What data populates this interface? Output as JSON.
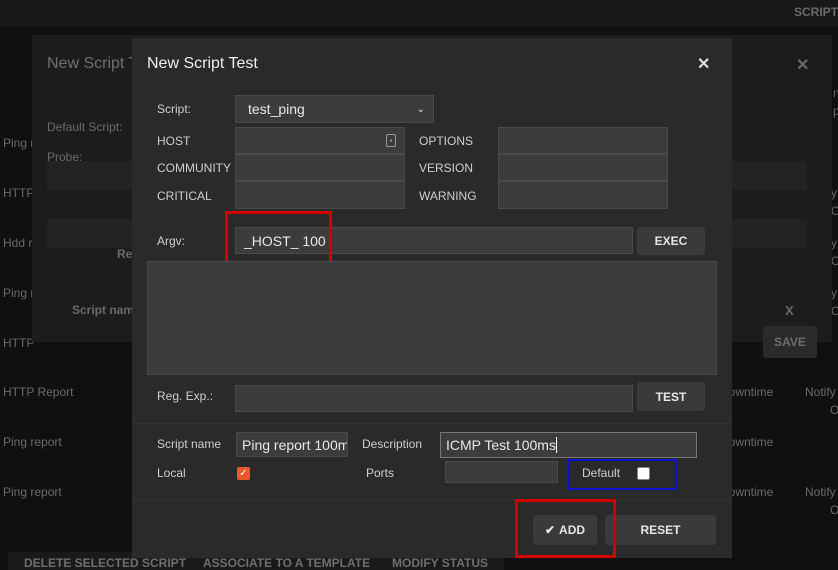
{
  "topbar": {
    "right_label": "SCRIPT"
  },
  "background_list": {
    "left_items": [
      "Ping r",
      "HTTP",
      "Hdd r",
      "Ping r",
      "HTTP",
      "HTTP Report",
      "Ping report",
      "Ping report"
    ],
    "right_downtime": "Downtime",
    "right_notify": "Notify",
    "right_o": "O",
    "right_partial": [
      "nt",
      "pe",
      "y",
      "O"
    ],
    "bottom_buttons": [
      "DELETE SELECTED SCRIPT",
      "ASSOCIATE TO A TEMPLATE",
      "MODIFY STATUS"
    ]
  },
  "back_modal": {
    "title": "New Script T",
    "default_script": "Default Script:",
    "probe": "Probe:",
    "re": "Re",
    "script_name": "Script name",
    "x": "X",
    "save": "SAVE"
  },
  "modal": {
    "title": "New Script Test",
    "script_label": "Script:",
    "script_value": "test_ping",
    "host": "HOST",
    "community": "COMMUNITY",
    "critical": "CRITICAL",
    "options": "OPTIONS",
    "version": "VERSION",
    "warning": "WARNING",
    "argv_label": "Argv:",
    "argv_value": "_HOST_ 100",
    "exec": "EXEC",
    "output": "",
    "regexp_label": "Reg. Exp.:",
    "regexp_value": "",
    "test": "TEST",
    "script_name_label": "Script name",
    "script_name_value": "Ping report 100ms",
    "description_label": "Description",
    "description_value": "ICMP Test 100ms",
    "local_label": "Local",
    "local_checked": true,
    "ports_label": "Ports",
    "ports_value": "",
    "default_label": "Default",
    "default_checked": false,
    "add": "ADD",
    "reset": "RESET"
  },
  "colors": {
    "accent": "#e9572b",
    "highlight_red": "#d00000",
    "highlight_blue": "#1010d0"
  }
}
